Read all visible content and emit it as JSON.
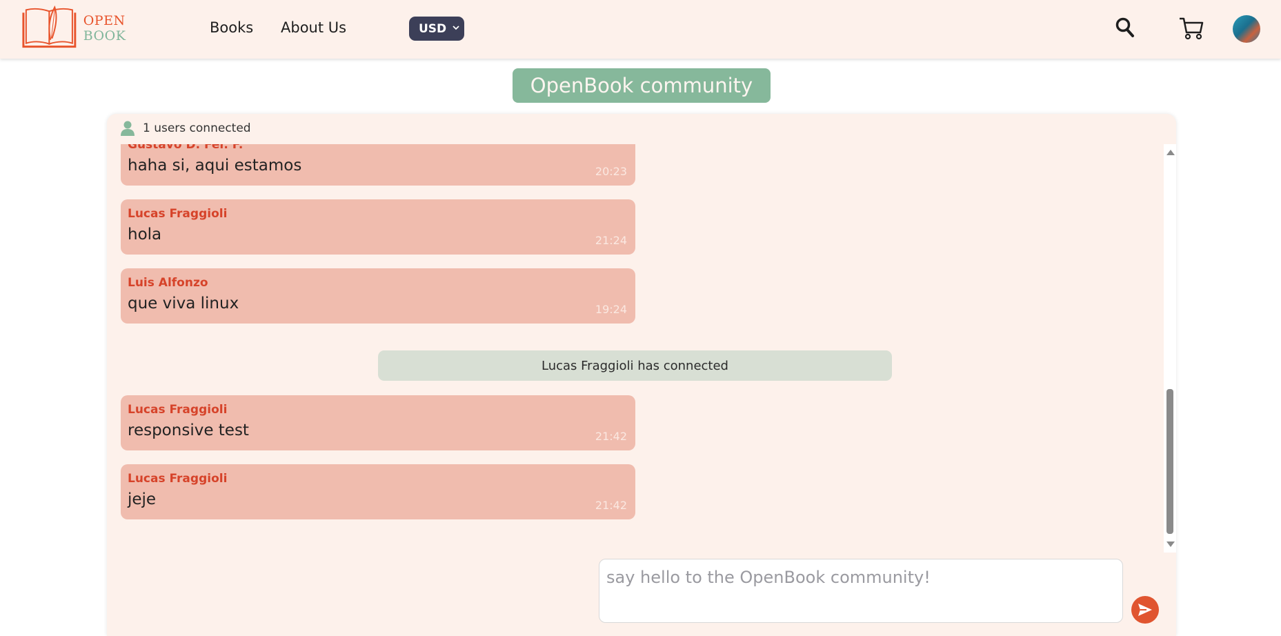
{
  "header": {
    "logo_open": "OPEN",
    "logo_book": "BOOK",
    "nav": [
      {
        "label": "Books"
      },
      {
        "label": "About Us"
      }
    ],
    "currency": "USD",
    "icons": {
      "search": "search-icon",
      "cart": "cart-icon",
      "avatar": "user-avatar"
    }
  },
  "community": {
    "title": "OpenBook community",
    "users_connected": "1 users connected"
  },
  "messages": [
    {
      "author": "Gustavo D. Fer. F.",
      "text": "haha si, aqui estamos",
      "time": "20:23"
    },
    {
      "author": "Lucas Fraggioli",
      "text": "hola",
      "time": "21:24"
    },
    {
      "author": "Luis Alfonzo",
      "text": "que viva linux",
      "time": "19:24"
    },
    {
      "author": "Lucas Fraggioli",
      "text": "responsive test",
      "time": "21:42"
    },
    {
      "author": "Lucas Fraggioli",
      "text": "jeje",
      "time": "21:42"
    }
  ],
  "system_message": "Lucas Fraggioli has connected",
  "composer": {
    "placeholder": "say hello to the OpenBook community!",
    "value": ""
  },
  "colors": {
    "navbar_bg": "#fdf1eb",
    "accent_orange": "#e8542c",
    "accent_green": "#86b89b",
    "bubble": "#f0bcae",
    "author": "#d6432a",
    "currency_bg": "#3c3f58",
    "system_bubble": "#d8dfd4"
  }
}
